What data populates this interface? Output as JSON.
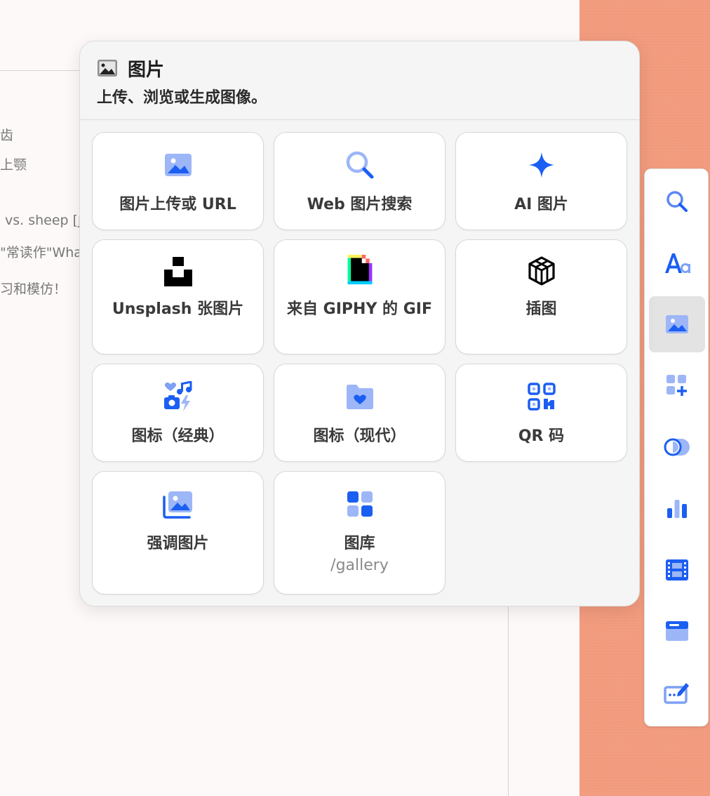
{
  "popup": {
    "title": "图片",
    "subtitle": "上传、浏览或生成图像。",
    "cards": [
      {
        "label": "图片上传或 URL",
        "icon": "image-upload-icon"
      },
      {
        "label": "Web 图片搜索",
        "icon": "search-icon"
      },
      {
        "label": "AI 图片",
        "icon": "sparkle-icon"
      },
      {
        "label": "Unsplash 张图片",
        "icon": "unsplash-logo-icon"
      },
      {
        "label": "来自 GIPHY 的 GIF",
        "icon": "giphy-logo-icon"
      },
      {
        "label": "插图",
        "icon": "illustration-cube-icon"
      },
      {
        "label": "图标（经典）",
        "icon": "icon-collection-icon"
      },
      {
        "label": "图标（现代）",
        "icon": "folder-heart-icon"
      },
      {
        "label": "QR 码",
        "icon": "qr-code-icon"
      },
      {
        "label": "强调图片",
        "icon": "accent-image-icon"
      },
      {
        "label": "图库",
        "sublabel": "/gallery",
        "icon": "gallery-grid-icon"
      }
    ]
  },
  "toolbar": {
    "items": [
      {
        "name": "search",
        "icon": "search-icon",
        "active": false
      },
      {
        "name": "text",
        "icon": "text-style-icon",
        "active": false
      },
      {
        "name": "image",
        "icon": "image-icon",
        "active": true
      },
      {
        "name": "add-block",
        "icon": "add-block-icon",
        "active": false
      },
      {
        "name": "toggle",
        "icon": "toggle-icon",
        "active": false
      },
      {
        "name": "chart",
        "icon": "bar-chart-icon",
        "active": false
      },
      {
        "name": "video",
        "icon": "film-icon",
        "active": false
      },
      {
        "name": "embed",
        "icon": "browser-window-icon",
        "active": false
      },
      {
        "name": "form",
        "icon": "edit-form-icon",
        "active": false
      }
    ]
  },
  "document": {
    "lines": [
      "齿",
      "上颚",
      "vs. sheep [ʃ",
      "\"常读作\"Wha",
      "习和模仿！"
    ]
  },
  "colors": {
    "accent": "#1b5ef2",
    "accent_light": "#9cb6f7",
    "popup_bg": "#f5f5f5",
    "side_bg": "#f29a7c"
  }
}
